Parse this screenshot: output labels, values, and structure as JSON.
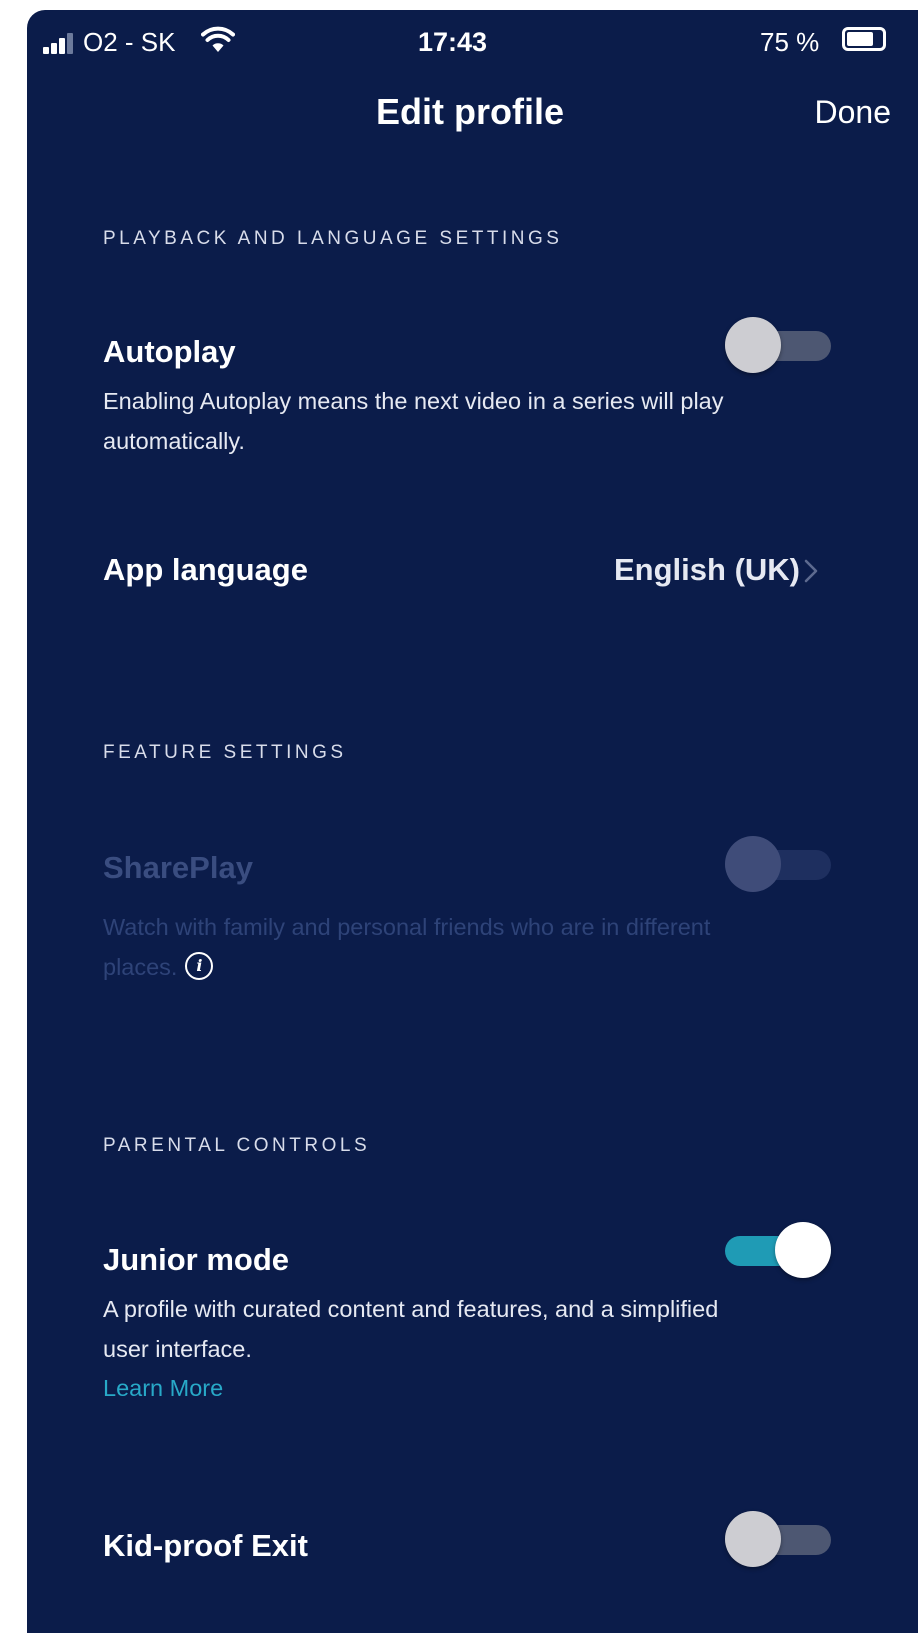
{
  "status_bar": {
    "carrier": "O2 - SK",
    "time": "17:43",
    "battery_percent": "75 %",
    "battery_level": 0.75
  },
  "nav": {
    "title": "Edit profile",
    "done_label": "Done"
  },
  "sections": {
    "playback": {
      "header": "PLAYBACK AND LANGUAGE SETTINGS",
      "autoplay": {
        "title": "Autoplay",
        "description": "Enabling Autoplay means the next video in a series will play automatically.",
        "enabled": false
      },
      "app_language": {
        "title": "App language",
        "value": "English (UK)"
      }
    },
    "features": {
      "header": "FEATURE SETTINGS",
      "shareplay": {
        "title": "SharePlay",
        "description": "Watch with family and personal friends who are in different places.",
        "enabled": false,
        "disabled": true
      }
    },
    "parental": {
      "header": "PARENTAL CONTROLS",
      "junior_mode": {
        "title": "Junior mode",
        "description": "A profile with curated content and features, and a simplified user interface.",
        "learn_more": "Learn More",
        "enabled": true
      },
      "kid_proof_exit": {
        "title": "Kid-proof Exit",
        "enabled": false
      }
    }
  },
  "colors": {
    "background": "#0b1c4a",
    "accent": "#1f9bb5",
    "link": "#28a9c8"
  }
}
